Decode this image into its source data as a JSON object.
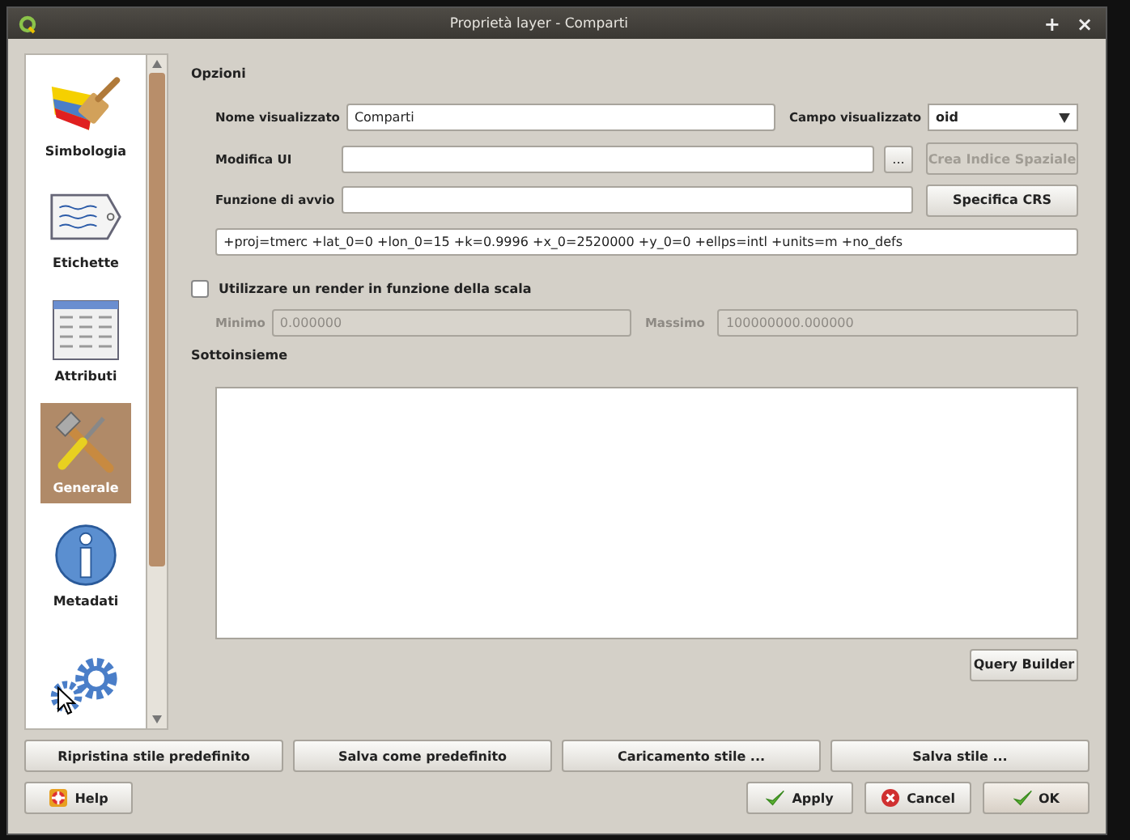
{
  "window": {
    "title": "Proprietà layer - Comparti",
    "buttons": [
      "+",
      "×"
    ]
  },
  "sidebar": {
    "items": [
      {
        "label": "Simbologia",
        "selected": false
      },
      {
        "label": "Etichette",
        "selected": false
      },
      {
        "label": "Attributi",
        "selected": false
      },
      {
        "label": "Generale",
        "selected": true
      },
      {
        "label": "Metadati",
        "selected": false
      },
      {
        "selected": false
      }
    ]
  },
  "options": {
    "heading": "Opzioni",
    "display_name": {
      "label": "Nome visualizzato",
      "value": "Comparti"
    },
    "display_field": {
      "label": "Campo visualizzato",
      "value": "oid"
    },
    "edit_ui": {
      "label": "Modifica UI",
      "browse": "..."
    },
    "spatial_index": {
      "label": "Crea Indice Spaziale",
      "disabled": true
    },
    "init_function": {
      "label": "Funzione di avvio"
    },
    "crs_button": "Specifica CRS",
    "crs": "+proj=tmerc +lat_0=0 +lon_0=15 +k=0.9996 +x_0=2520000 +y_0=0 +ellps=intl +units=m +no_defs",
    "scale": {
      "label": "Utilizzare un render in funzione della scala",
      "checked": false,
      "min_label": "Minimo",
      "min": "0.000000",
      "max_label": "Massimo",
      "max": "100000000.000000"
    }
  },
  "subset": {
    "heading": "Sottoinsieme",
    "query_builder": "Query Builder"
  },
  "style_buttons": [
    "Ripristina stile predefinito",
    "Salva come predefinito",
    "Caricamento stile ...",
    "Salva stile ..."
  ],
  "help": "Help",
  "dialog_buttons": [
    {
      "kind": "apply",
      "label": "Apply"
    },
    {
      "kind": "cancel",
      "label": "Cancel"
    },
    {
      "kind": "ok",
      "label": "OK"
    }
  ]
}
